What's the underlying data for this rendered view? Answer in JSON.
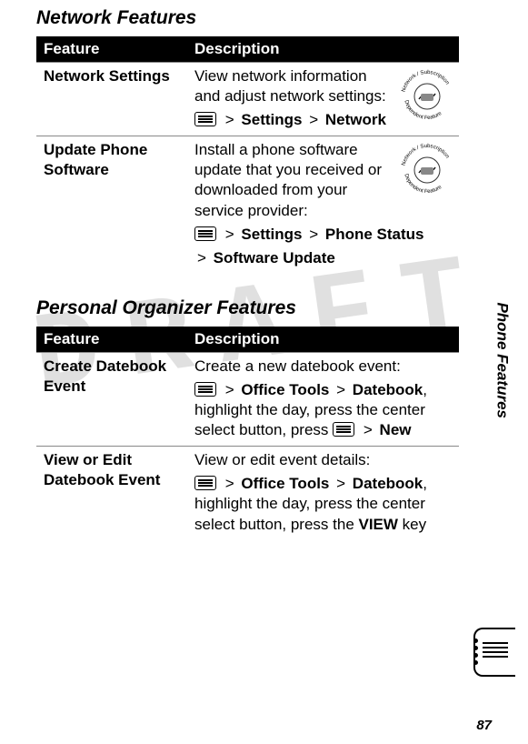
{
  "headings": {
    "network": "Network Features",
    "organizer": "Personal Organizer Features"
  },
  "tableHeaders": {
    "feature": "Feature",
    "description": "Description"
  },
  "network": {
    "rows": [
      {
        "feature": "Network Settings",
        "desc": "View network information and adjust network settings:",
        "nav1": "Settings",
        "nav2": "Network"
      },
      {
        "feature": "Update Phone Software",
        "desc": "Install a phone software update that you received or downloaded from your service provider:",
        "nav1": "Settings",
        "nav2": "Phone Status",
        "nav3": "Software Update"
      }
    ]
  },
  "organizer": {
    "rows": [
      {
        "feature": "Create Datebook Event",
        "desc_pre": "Create a new datebook event:",
        "nav1": "Office Tools",
        "nav2": "Datebook",
        "after": ", highlight the day, press the center select button, press ",
        "nav3": "New"
      },
      {
        "feature": "View or Edit Datebook Event",
        "desc_pre": "View or edit event details:",
        "nav1": "Office Tools",
        "nav2": "Datebook",
        "after": ", highlight the day, press the center select button, press the ",
        "nav3": "VIEW",
        "after2": " key"
      }
    ]
  },
  "badge": {
    "top": "Network / Subscription",
    "bottom": "Dependent Feature"
  },
  "sideTab": "Phone Features",
  "pageNumber": "87",
  "watermark": "DRAFT"
}
